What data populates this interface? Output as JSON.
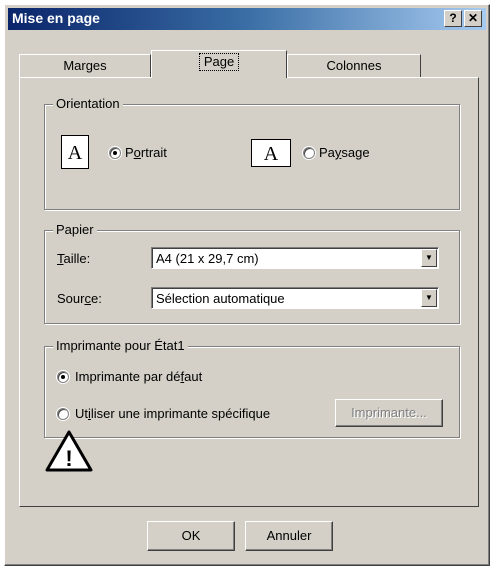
{
  "window": {
    "title": "Mise en page",
    "help_glyph": "?",
    "close_glyph": "✕"
  },
  "tabs": {
    "margins": "Marges",
    "page": "Page",
    "columns": "Colonnes"
  },
  "orientation": {
    "group_label": "Orientation",
    "icon_glyph": "A",
    "portrait": {
      "pre": "P",
      "key": "o",
      "post": "rtrait"
    },
    "landscape": {
      "pre": "Pa",
      "key": "y",
      "post": "sage"
    },
    "selected": "Portrait"
  },
  "paper": {
    "group_label": "Papier",
    "size_label": {
      "key": "T",
      "post": "aille:"
    },
    "size_value": "A4 (21 x 29,7 cm)",
    "source_label": {
      "pre": "Sour",
      "key": "c",
      "post": "e:"
    },
    "source_value": "Sélection automatique",
    "arrow_glyph": "▼"
  },
  "printer": {
    "group_label": "Imprimante pour État1",
    "default": {
      "pre": "Imprimante par dé",
      "key": "f",
      "post": "aut"
    },
    "specific": {
      "pre": "Ut",
      "key": "i",
      "post": "liser une imprimante spécifique"
    },
    "printer_button": "Imprimante...",
    "selected": "default",
    "warning_glyph": "!"
  },
  "buttons": {
    "ok": "OK",
    "cancel": "Annuler"
  }
}
